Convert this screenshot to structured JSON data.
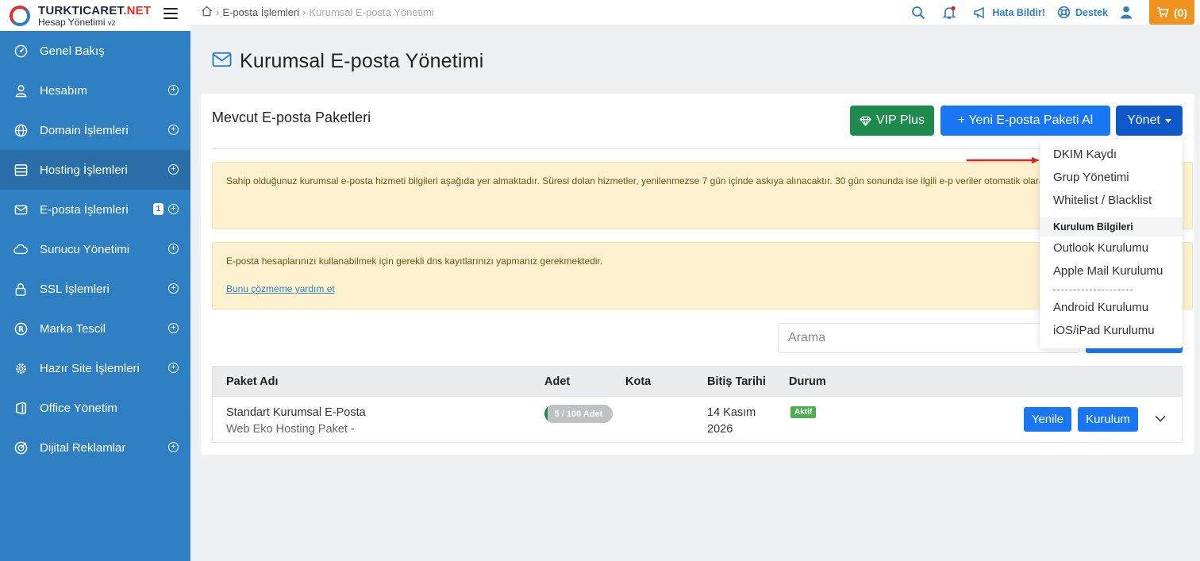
{
  "brand": {
    "name_main": "TURKTICARET",
    "name_dot": ".",
    "name_tld": "NET",
    "subtitle": "Hesap Yönetimi",
    "version": "v2"
  },
  "sidebar": {
    "items": [
      {
        "label": "Genel Bakış",
        "icon": "gauge-icon",
        "expandable": false
      },
      {
        "label": "Hesabım",
        "icon": "user-icon",
        "expandable": true
      },
      {
        "label": "Domain İşlemleri",
        "icon": "globe-icon",
        "expandable": true
      },
      {
        "label": "Hosting İşlemleri",
        "icon": "server-icon",
        "expandable": true,
        "active": true
      },
      {
        "label": "E-posta İşlemleri",
        "icon": "mail-icon",
        "expandable": true,
        "badge": "1"
      },
      {
        "label": "Sunucu Yönetimi",
        "icon": "cloud-icon",
        "expandable": true
      },
      {
        "label": "SSL İşlemleri",
        "icon": "lock-icon",
        "expandable": true
      },
      {
        "label": "Marka Tescil",
        "icon": "registered-icon",
        "expandable": true
      },
      {
        "label": "Hazır Site İşlemleri",
        "icon": "gear-icon",
        "expandable": true
      },
      {
        "label": "Office Yönetim",
        "icon": "office-icon",
        "expandable": false
      },
      {
        "label": "Dijital Reklamlar",
        "icon": "target-icon",
        "expandable": true
      }
    ]
  },
  "topbar": {
    "breadcrumb": {
      "home_icon": "home-icon",
      "item1": "E-posta İşlemleri",
      "item2": "Kurumsal E-posta Yönetimi"
    },
    "report_label": "Hata Bildir!",
    "support_label": "Destek",
    "cart_label": "(0)"
  },
  "page": {
    "title": "Kurumsal E-posta Yönetimi"
  },
  "card": {
    "title": "Mevcut E-posta Paketleri",
    "vip_label": "VIP Plus",
    "new_package_label": "+ Yeni E-posta Paketi Al",
    "manage_label": "Yönet",
    "alert1": "Sahip olduğunuz kurumsal e-posta hizmeti bilgileri aşağıda yer almaktadır. Süresi dolan hizmetler, yenilenmezse 7 gün içinde askıya alınacaktır. 30 gün sonunda ise ilgili e-p veriler otomatik olarak silinecektir.",
    "alert2": "E-posta hesaplarınızı kullanabilmek için gerekli dns kayıtlarınızı yapmanız gerekmektedir.",
    "help_link": "Bunu çözmeme yardım et",
    "search_placeholder": "Arama"
  },
  "table": {
    "headers": {
      "name": "Paket Adı",
      "count": "Adet",
      "quota": "Kota",
      "end_date": "Bitiş Tarihi",
      "status": "Durum"
    },
    "rows": [
      {
        "name": "Standart Kurumsal E-Posta",
        "subname": "Web Eko Hosting Paket -",
        "count_label": "5 / 100 Adet",
        "count_used": 5,
        "count_total": 100,
        "date_line1": "14 Kasım",
        "date_line2": "2026",
        "status": "Aktif",
        "renew_label": "Yenile",
        "setup_label": "Kurulum"
      }
    ]
  },
  "dropdown": {
    "items": [
      "DKIM Kaydı",
      "Grup Yönetimi",
      "Whitelist / Blacklist"
    ],
    "section_header": "Kurulum Bilgileri",
    "setup_items": [
      "Outlook Kurulumu",
      "Apple Mail Kurulumu"
    ],
    "mobile_items": [
      "Android Kurulumu",
      "iOS/iPad Kurulumu"
    ]
  },
  "colors": {
    "sidebar": "#2e80c2",
    "primary": "#1977f3",
    "vip": "#1e8a4d",
    "cart": "#f0931e",
    "alert_bg": "#fdf1cf"
  }
}
